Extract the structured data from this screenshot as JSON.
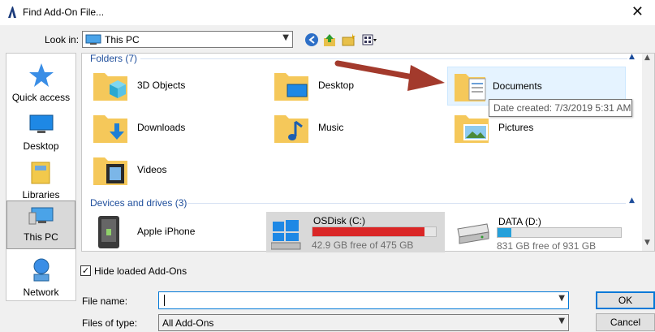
{
  "window": {
    "title": "Find Add-On File...",
    "close_glyph": "✕"
  },
  "look_in": {
    "label": "Look in:",
    "value": "This PC"
  },
  "nav": {
    "items": [
      {
        "label": "Quick access",
        "icon": "star-icon"
      },
      {
        "label": "Desktop",
        "icon": "desktop-icon"
      },
      {
        "label": "Libraries",
        "icon": "libraries-icon"
      },
      {
        "label": "This PC",
        "icon": "computer-icon",
        "selected": true
      },
      {
        "label": "Network",
        "icon": "network-icon"
      }
    ]
  },
  "groups": {
    "folders": {
      "header": "Folders (7)"
    },
    "drives": {
      "header": "Devices and drives (3)"
    }
  },
  "folders": [
    {
      "name": "3D Objects",
      "icon": "3d-objects-folder-icon"
    },
    {
      "name": "Desktop",
      "icon": "desktop-folder-icon"
    },
    {
      "name": "Documents",
      "icon": "documents-folder-icon"
    },
    {
      "name": "Downloads",
      "icon": "downloads-folder-icon"
    },
    {
      "name": "Music",
      "icon": "music-folder-icon"
    },
    {
      "name": "Pictures",
      "icon": "pictures-folder-icon"
    },
    {
      "name": "Videos",
      "icon": "videos-folder-icon"
    }
  ],
  "drives": [
    {
      "name": "Apple iPhone",
      "icon": "phone-device-icon"
    },
    {
      "name": "OSDisk (C:)",
      "icon": "windows-drive-icon",
      "free": "42.9 GB free of 475 GB",
      "used_fraction": 0.91,
      "bar_color": "#da2626"
    },
    {
      "name": "DATA (D:)",
      "icon": "hard-drive-icon",
      "free": "831 GB free of 931 GB",
      "used_fraction": 0.11,
      "bar_color": "#26a0da"
    }
  ],
  "tooltip": "Date created: 7/3/2019 5:31 AM",
  "options": {
    "hide_loaded_label": "Hide loaded Add-Ons",
    "hide_loaded_checked": "✓"
  },
  "file_name": {
    "label": "File name:",
    "value": ""
  },
  "files_of_type": {
    "label": "Files of type:",
    "value": "All Add-Ons"
  },
  "buttons": {
    "ok": "OK",
    "cancel": "Cancel"
  },
  "colors": {
    "accent": "#0078d7",
    "group_text": "#1e4e9c",
    "selection": "#cce8ff",
    "annotation_arrow": "#a33a2c"
  }
}
